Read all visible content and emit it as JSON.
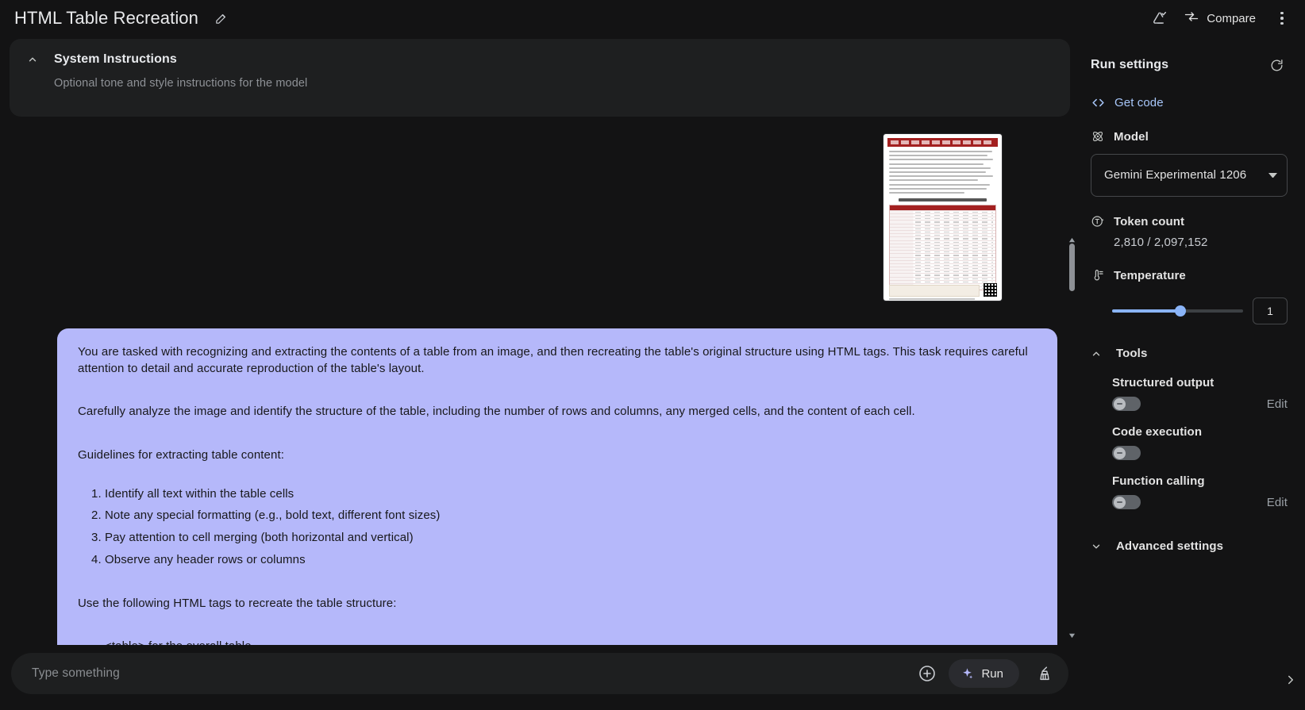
{
  "topbar": {
    "title": "HTML Table Recreation",
    "edit_icon": "pencil-icon",
    "save_icon": "save-to-drive-icon",
    "compare_label": "Compare",
    "compare_icon": "compare-arrows-icon",
    "more_icon": "more-vert-icon"
  },
  "system_instructions": {
    "title": "System Instructions",
    "placeholder": "Optional tone and style instructions for the model",
    "collapse_icon": "chevron-up-icon"
  },
  "attachment": {
    "name": "uploaded-document-thumbnail",
    "description": "Chinese financial report page with red-header data table"
  },
  "prompt": {
    "paragraph_1": "You are tasked with recognizing and extracting the contents of a table from an image, and then recreating the table's original structure using HTML tags. This task requires careful attention to detail and accurate reproduction of the table's layout.",
    "paragraph_2": "Carefully analyze the image and identify the structure of the table, including the number of rows and columns, any merged cells, and the content of each cell.",
    "paragraph_3": "Guidelines for extracting table content:",
    "guidelines": [
      "Identify all text within the table cells",
      "Note any special formatting (e.g., bold text, different font sizes)",
      "Pay attention to cell merging (both horizontal and vertical)",
      "Observe any header rows or columns"
    ],
    "paragraph_4": "Use the following HTML tags to recreate the table structure:",
    "tags": [
      "<table> for the overall table"
    ]
  },
  "input_bar": {
    "placeholder": "Type something",
    "value": "",
    "add_icon": "plus-circle-icon",
    "run_label": "Run",
    "run_icon": "sparkle-icon",
    "clear_icon": "broom-icon"
  },
  "run_settings": {
    "title": "Run settings",
    "reset_icon": "refresh-icon",
    "get_code": {
      "label": "Get code",
      "icon": "code-brackets-icon",
      "color": "#a8c7fa"
    },
    "model": {
      "label": "Model",
      "icon": "model-atom-icon",
      "selected": "Gemini Experimental 1206",
      "dropdown_icon": "caret-down-icon"
    },
    "token_count": {
      "label": "Token count",
      "icon": "token-icon",
      "value": "2,810 / 2,097,152"
    },
    "temperature": {
      "label": "Temperature",
      "icon": "thermostat-icon",
      "value": "1",
      "slider_percent": 52,
      "accent": "#8ab4f8"
    },
    "tools": {
      "label": "Tools",
      "collapse_icon": "chevron-up-icon",
      "items": [
        {
          "name": "Structured output",
          "enabled": false,
          "edit_label": "Edit",
          "has_edit": true
        },
        {
          "name": "Code execution",
          "enabled": false,
          "edit_label": "",
          "has_edit": false
        },
        {
          "name": "Function calling",
          "enabled": false,
          "edit_label": "Edit",
          "has_edit": true
        }
      ]
    },
    "advanced": {
      "label": "Advanced settings",
      "expand_icon": "chevron-down-icon"
    },
    "collapse_panel_icon": "chevron-right-icon"
  }
}
